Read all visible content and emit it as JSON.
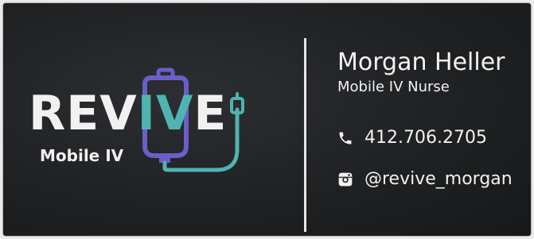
{
  "logo": {
    "word_left": "REV",
    "word_accent": "IV",
    "word_right": "E",
    "subtitle": "Mobile IV"
  },
  "contact_person": {
    "name": "Morgan Heller",
    "title": "Mobile IV Nurse"
  },
  "contacts": {
    "phone": "412.706.2705",
    "instagram": "@revive_morgan"
  },
  "colors": {
    "card_background": "#1f2123",
    "text": "#f1f1f1",
    "teal_accent": "#4fb3b0",
    "purple_accent": "#6a5fc8"
  },
  "icons": {
    "phone": "phone-icon",
    "instagram": "instagram-icon"
  }
}
